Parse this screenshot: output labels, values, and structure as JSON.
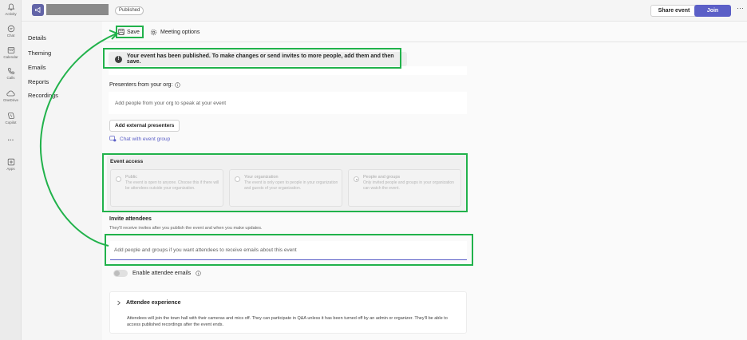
{
  "rail": {
    "items": [
      {
        "label": "Activity",
        "icon": "bell-icon"
      },
      {
        "label": "Chat",
        "icon": "chat-icon"
      },
      {
        "label": "Calendar",
        "icon": "calendar-icon"
      },
      {
        "label": "Calls",
        "icon": "phone-icon"
      },
      {
        "label": "OneDrive",
        "icon": "cloud-icon"
      },
      {
        "label": "Copilot",
        "icon": "copilot-icon"
      },
      {
        "label": "",
        "icon": "more-icon"
      },
      {
        "label": "Apps",
        "icon": "plus-square-icon"
      }
    ]
  },
  "header": {
    "status_badge": "Published",
    "share_label": "Share event",
    "join_label": "Join",
    "more_label": "···"
  },
  "leftnav": {
    "items": [
      "Details",
      "Theming",
      "Emails",
      "Reports",
      "Recordings"
    ]
  },
  "toolbar": {
    "save_label": "Save",
    "meeting_options_label": "Meeting options"
  },
  "banner": {
    "text": "Your event has been published. To make changes or send invites to more people, add them and then save."
  },
  "presenters": {
    "label": "Presenters from your org:",
    "placeholder": "Add people from your org to speak at your event",
    "external_button": "Add external presenters",
    "chat_link": "Chat with event group"
  },
  "access": {
    "title": "Event access",
    "options": [
      {
        "title": "Public",
        "desc": "The event is open to anyone. Choose this if there will be attendees outside your organization.",
        "selected": false
      },
      {
        "title": "Your organization",
        "desc": "The event is only open to people in your organization and guests of your organization.",
        "selected": false
      },
      {
        "title": "People and groups",
        "desc": "Only invited people and groups in your organization can watch the event.",
        "selected": true
      }
    ]
  },
  "invite": {
    "title": "Invite attendees",
    "subtitle": "They'll receive invites after you publish the event and when you make updates.",
    "placeholder": "Add people and groups if you want attendees to receive emails about this event"
  },
  "emails_toggle": {
    "label": "Enable attendee emails",
    "on": false
  },
  "experience": {
    "title": "Attendee experience",
    "body": "Attendees will join the town hall with their cameras and mics off. They can participate in Q&A unless it has been turned off by an admin or organizer. They'll be able to access published recordings after the event ends."
  },
  "colors": {
    "accent": "#5b5fc7",
    "annotation": "#21b24b"
  }
}
